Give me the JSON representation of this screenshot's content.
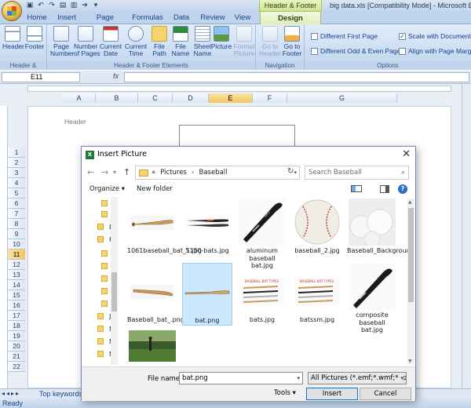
{
  "window": {
    "title": "big data.xls  [Compatibility Mode] - Microsoft Excel",
    "context_tab": "Header & Footer Tools"
  },
  "ribbon": {
    "tabs": [
      "Home",
      "Insert",
      "Page Layout",
      "Formulas",
      "Data",
      "Review",
      "View",
      "Design"
    ],
    "active_tab": "Design",
    "groups": {
      "header_footer": {
        "label": "Header & Footer",
        "buttons": [
          {
            "label": "Header",
            "icon": "header-icon"
          },
          {
            "label": "Footer",
            "icon": "footer-icon"
          }
        ]
      },
      "elements": {
        "label": "Header & Footer Elements",
        "buttons": [
          {
            "label": "Page\nNumber",
            "icon": "page-number-icon"
          },
          {
            "label": "Number\nof Pages",
            "icon": "number-of-pages-icon"
          },
          {
            "label": "Current\nDate",
            "icon": "calendar-icon"
          },
          {
            "label": "Current\nTime",
            "icon": "clock-icon"
          },
          {
            "label": "File\nPath",
            "icon": "folder-icon"
          },
          {
            "label": "File\nName",
            "icon": "excel-file-icon"
          },
          {
            "label": "Sheet\nName",
            "icon": "sheet-icon"
          },
          {
            "label": "Picture",
            "icon": "picture-icon"
          },
          {
            "label": "Format\nPicture",
            "icon": "format-picture-icon"
          }
        ]
      },
      "navigation": {
        "label": "Navigation",
        "buttons": [
          {
            "label": "Go to\nHeader",
            "icon": "go-to-header-icon"
          },
          {
            "label": "Go to\nFooter",
            "icon": "go-to-footer-icon"
          }
        ]
      },
      "options": {
        "label": "Options",
        "checkboxes": [
          {
            "label": "Different First Page",
            "checked": false
          },
          {
            "label": "Scale with Document",
            "checked": true
          },
          {
            "label": "Different Odd & Even Pages",
            "checked": false
          },
          {
            "label": "Align with Page Margins",
            "checked": false
          }
        ]
      }
    }
  },
  "formula_bar": {
    "name_box": "E11",
    "fx": "fx",
    "value": ""
  },
  "sheet": {
    "columns": [
      "A",
      "B",
      "C",
      "D",
      "E",
      "F",
      "G"
    ],
    "selected_column": "E",
    "rows": [
      "1",
      "2",
      "3",
      "4",
      "5",
      "6",
      "7",
      "8",
      "9",
      "10",
      "11",
      "12",
      "13",
      "14",
      "15",
      "16",
      "17",
      "18",
      "19",
      "20",
      "21",
      "22"
    ],
    "selected_row": "11",
    "header_text": "Header",
    "tab_name": "Top keywords",
    "status": "Ready"
  },
  "dialog": {
    "title": "Insert Picture",
    "breadcrumb": [
      "«",
      "Pictures",
      "›",
      "Baseball"
    ],
    "search_placeholder": "Search Baseball",
    "organize": "Organize ▾",
    "new_folder": "New folder",
    "nav_labels": [
      "D",
      "F",
      "Js",
      "M",
      "N",
      "M"
    ],
    "files": [
      {
        "name": "1061baseball_bat_1.jpg",
        "thumb": "bat"
      },
      {
        "name": "5150-bats.jpg",
        "thumb": "bats-pair"
      },
      {
        "name": "aluminum baseball bat.jpg",
        "thumb": "black-bat"
      },
      {
        "name": "baseball_2.jpg",
        "thumb": "ball"
      },
      {
        "name": "Baseball_Background.jpg",
        "thumb": "background"
      },
      {
        "name": "Baseball_bat_.png",
        "thumb": "bat"
      },
      {
        "name": "bat.png",
        "thumb": "bat-flat"
      },
      {
        "name": "bats.jpg",
        "thumb": "bats-chart"
      },
      {
        "name": "batssm.jpg",
        "thumb": "bats-chart"
      },
      {
        "name": "composite baseball bat.jpg",
        "thumb": "black-bat"
      },
      {
        "name": "",
        "thumb": "field"
      }
    ],
    "selected_file": "bat.png",
    "file_name_label": "File name:",
    "file_name_value": "bat.png",
    "filter_value": "All Pictures (*.emf;*.wmf;*.jpg;*",
    "tools": "Tools",
    "insert": "Insert",
    "cancel": "Cancel"
  }
}
